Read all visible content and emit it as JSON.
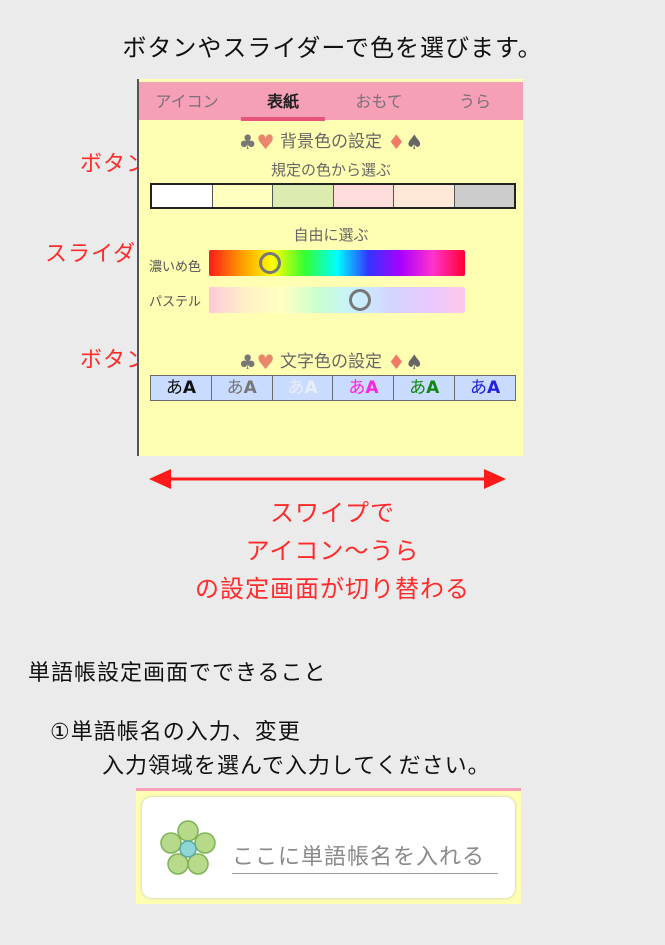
{
  "heading": "ボタンやスライダーで色を選びます。",
  "tabs": [
    {
      "label": "アイコン",
      "active": false
    },
    {
      "label": "表紙",
      "active": true
    },
    {
      "label": "おもて",
      "active": false
    },
    {
      "label": "うら",
      "active": false
    }
  ],
  "background_section": {
    "title": "背景色の設定",
    "preset_label": "規定の色から選ぶ",
    "preset_colors": [
      "#ffffff",
      "#ffffc0",
      "#dcecb0",
      "#ffdcdc",
      "#ffe8d8",
      "#cccccc"
    ],
    "free_label": "自由に選ぶ",
    "sliders": [
      {
        "label": "濃いめ色",
        "value_fraction": 0.24
      },
      {
        "label": "パステル",
        "value_fraction": 0.59
      }
    ]
  },
  "text_section": {
    "title": "文字色の設定",
    "buttons": [
      {
        "a": "あ",
        "b": "A",
        "color": "#111111"
      },
      {
        "a": "あ",
        "b": "A",
        "color": "#777777"
      },
      {
        "a": "あ",
        "b": "A",
        "color": "#e8eef8"
      },
      {
        "a": "あ",
        "b": "A",
        "color": "#ff22dd"
      },
      {
        "a": "あ",
        "b": "A",
        "color": "#118811"
      },
      {
        "a": "あ",
        "b": "A",
        "color": "#2222dd"
      }
    ]
  },
  "callouts": {
    "button_1": "ボタン",
    "slider": "スライダー",
    "button_2": "ボタン"
  },
  "swipe_text": [
    "スワイプで",
    "アイコン～うら",
    "の設定画面が切り替わる"
  ],
  "section_heading": "単語帳設定画面でできること",
  "item_1": "①単語帳名の入力、変更",
  "item_1_desc": "入力領域を選んで入力してください。",
  "input": {
    "placeholder": "ここに単語帳名を入れる"
  },
  "colors": {
    "accent": "#ff2b2b",
    "panel_bg": "#ffffb3",
    "tab_bar": "#f6a0b8"
  }
}
